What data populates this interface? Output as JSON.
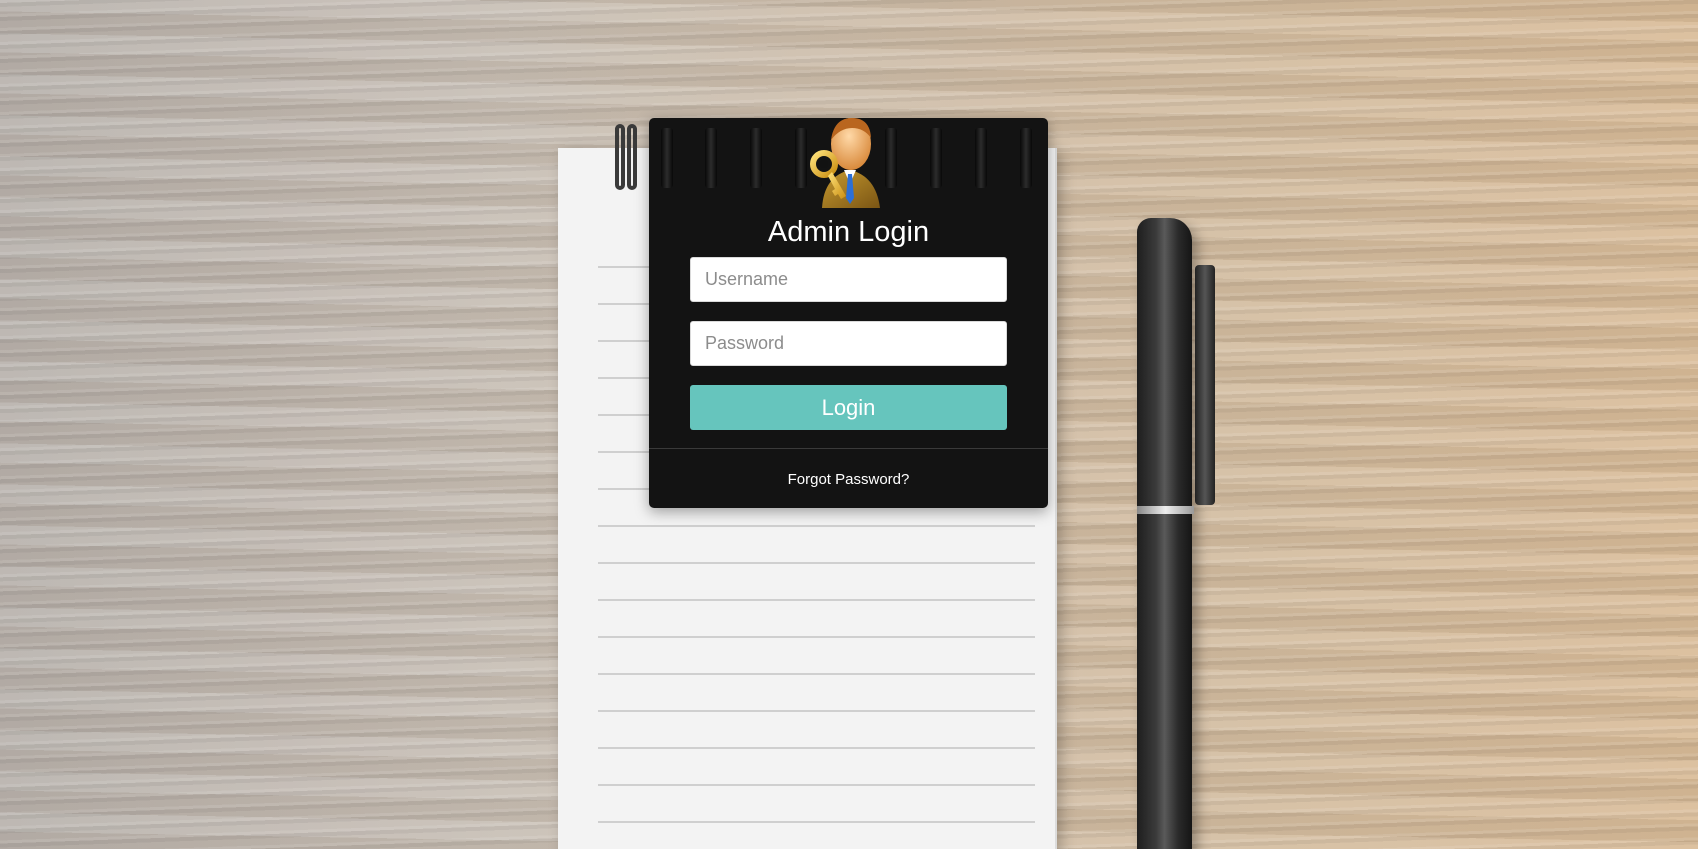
{
  "login": {
    "title": "Admin Login",
    "username_placeholder": "Username",
    "password_placeholder": "Password",
    "login_label": "Login",
    "forgot_label": "Forgot Password?"
  },
  "icons": {
    "avatar": "admin-key-user-icon"
  },
  "colors": {
    "card_background": "#131313",
    "login_button": "#66c5bd",
    "text_light": "#ffffff"
  }
}
